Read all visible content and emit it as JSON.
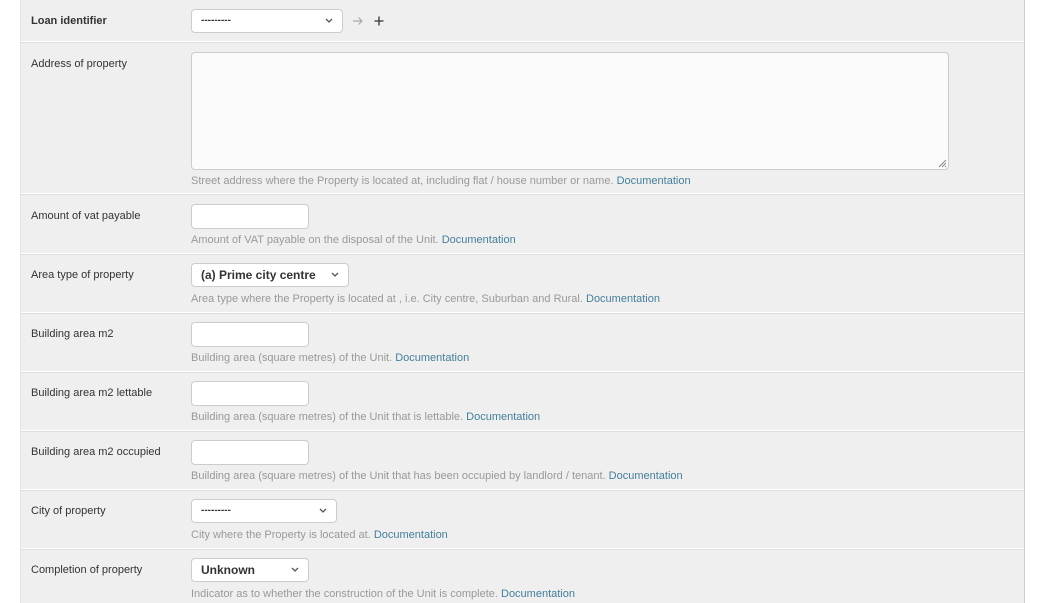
{
  "fields": {
    "loan_identifier": {
      "label": "Loan identifier",
      "value": "---------"
    },
    "address": {
      "label": "Address of property",
      "value": "",
      "help": "Street address where the Property is located at, including flat / house number or name.",
      "doc": "Documentation"
    },
    "vat": {
      "label": "Amount of vat payable",
      "value": "",
      "help": "Amount of VAT payable on the disposal of the Unit.",
      "doc": "Documentation"
    },
    "area_type": {
      "label": "Area type of property",
      "value": "(a) Prime city centre",
      "help": "Area type where the Property is located at , i.e. City centre, Suburban and Rural.",
      "doc": "Documentation"
    },
    "building_area": {
      "label": "Building area m2",
      "value": "",
      "help": "Building area (square metres) of the Unit.",
      "doc": "Documentation"
    },
    "building_area_lettable": {
      "label": "Building area m2 lettable",
      "value": "",
      "help": "Building area (square metres) of the Unit that is lettable.",
      "doc": "Documentation"
    },
    "building_area_occupied": {
      "label": "Building area m2 occupied",
      "value": "",
      "help": "Building area (square metres) of the Unit that has been occupied by landlord / tenant.",
      "doc": "Documentation"
    },
    "city": {
      "label": "City of property",
      "value": "---------",
      "help": "City where the Property is located at.",
      "doc": "Documentation"
    },
    "completion": {
      "label": "Completion of property",
      "value": "Unknown",
      "help": "Indicator as to whether the construction of the Unit is complete.",
      "doc": "Documentation"
    }
  },
  "icons": {
    "view": "arrow-right-icon",
    "add": "plus-icon",
    "dropdown": "chevron-down-icon"
  },
  "colors": {
    "panel": "#efefef",
    "link": "#447e9b",
    "help": "#999999",
    "border": "#cccccc"
  }
}
